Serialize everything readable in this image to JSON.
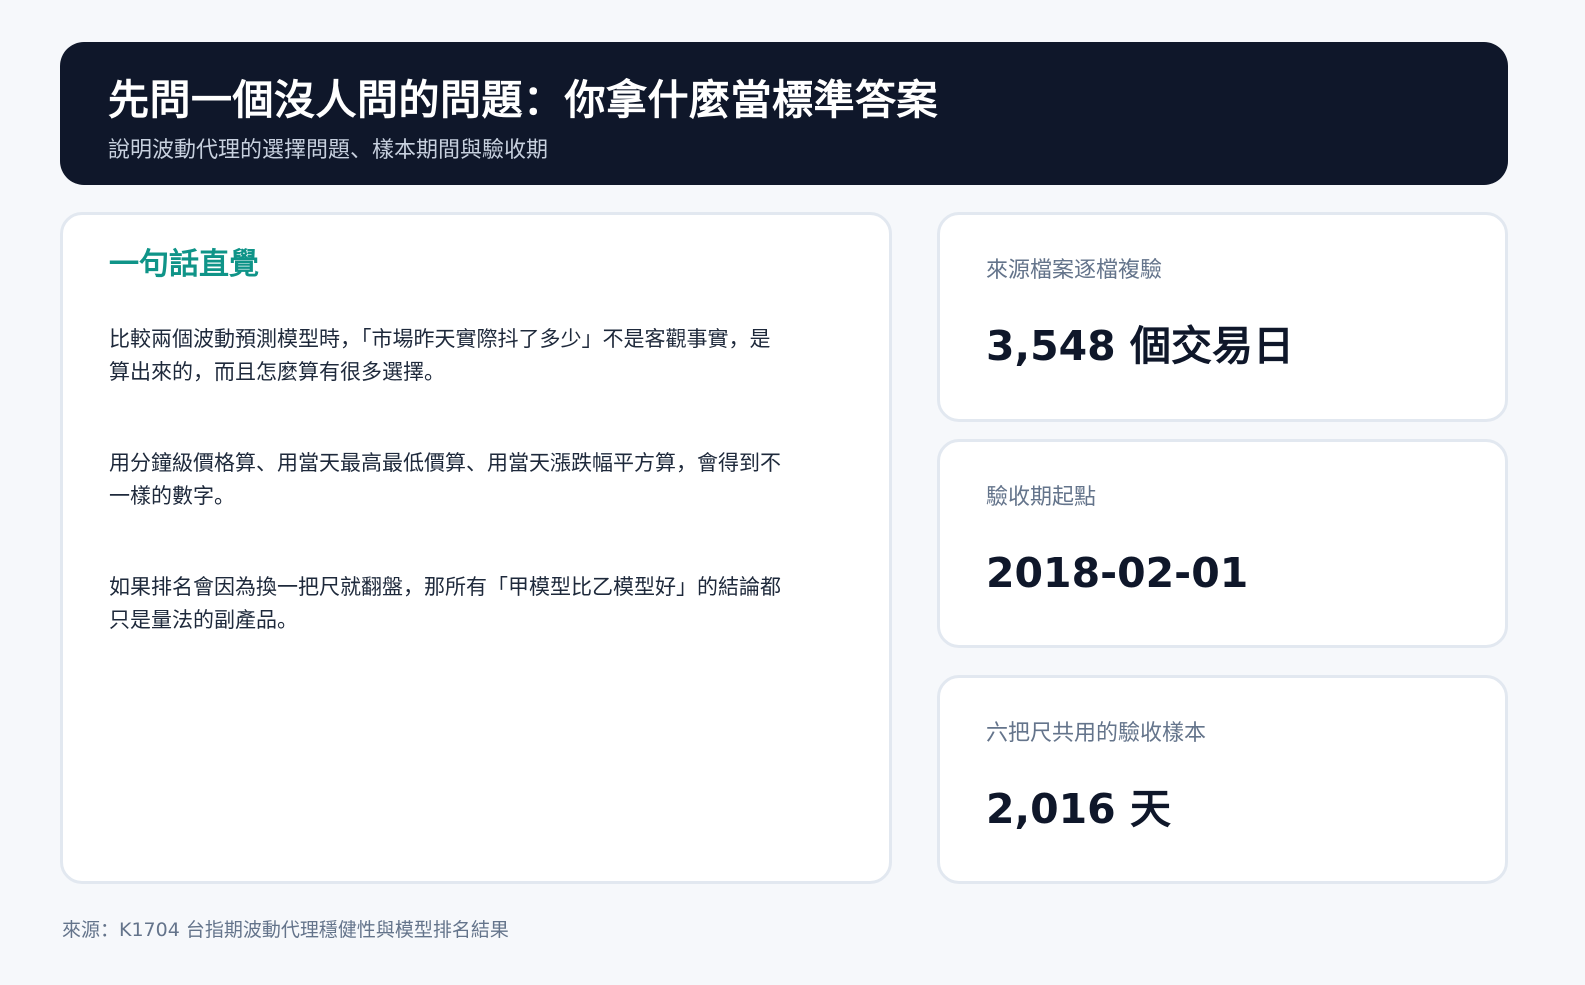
{
  "header": {
    "title": "先問一個沒人問的問題：你拿什麼當標準答案",
    "subtitle": "說明波動代理的選擇問題、樣本期間與驗收期"
  },
  "main": {
    "heading": "一句話直覺",
    "paragraphs": [
      "比較兩個波動預測模型時，「市場昨天實際抖了多少」不是客觀事實，是算出來的，而且怎麼算有很多選擇。",
      "用分鐘級價格算、用當天最高最低價算、用當天漲跌幅平方算，會得到不一樣的數字。",
      "如果排名會因為換一把尺就翻盤，那所有「甲模型比乙模型好」的結論都只是量法的副產品。"
    ]
  },
  "stats": [
    {
      "label": "來源檔案逐檔複驗",
      "value": "3,548 個交易日"
    },
    {
      "label": "驗收期起點",
      "value": "2018-02-01"
    },
    {
      "label": "六把尺共用的驗收樣本",
      "value": "2,016 天"
    }
  ],
  "source": "來源：K1704 台指期波動代理穩健性與模型排名結果"
}
